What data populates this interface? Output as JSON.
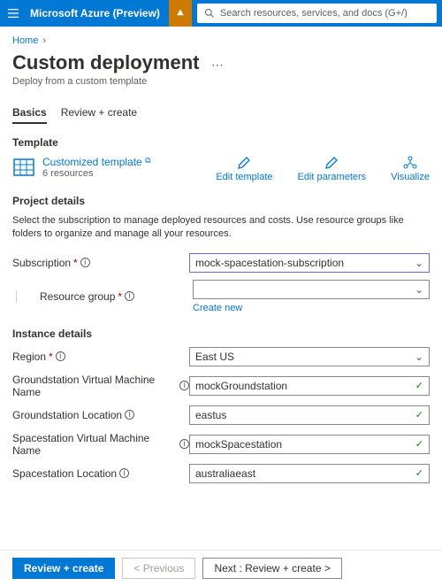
{
  "header": {
    "brand": "Microsoft Azure (Preview)",
    "search_placeholder": "Search resources, services, and docs (G+/)"
  },
  "breadcrumb": {
    "home": "Home"
  },
  "title": "Custom deployment",
  "subtitle": "Deploy from a custom template",
  "tabs": {
    "basics": "Basics",
    "review": "Review + create"
  },
  "template_section": {
    "heading": "Template",
    "name": "Customized template",
    "resources": "6 resources",
    "edit_template": "Edit template",
    "edit_parameters": "Edit parameters",
    "visualize": "Visualize"
  },
  "project": {
    "heading": "Project details",
    "intro": "Select the subscription to manage deployed resources and costs. Use resource groups like folders to organize and manage all your resources.",
    "subscription_label": "Subscription",
    "subscription_value": "mock-spacestation-subscription",
    "resource_group_label": "Resource group",
    "resource_group_value": "",
    "create_new": "Create new"
  },
  "instance": {
    "heading": "Instance details",
    "fields": {
      "region": {
        "label": "Region",
        "required": true,
        "type": "select",
        "value": "East US"
      },
      "gs_name": {
        "label": "Groundstation Virtual Machine Name",
        "required": false,
        "type": "text",
        "value": "mockGroundstation"
      },
      "gs_loc": {
        "label": "Groundstation Location",
        "required": false,
        "type": "text",
        "value": "eastus"
      },
      "ss_name": {
        "label": "Spacestation Virtual Machine Name",
        "required": false,
        "type": "text",
        "value": "mockSpacestation"
      },
      "ss_loc": {
        "label": "Spacestation Location",
        "required": false,
        "type": "text",
        "value": "australiaeast"
      }
    }
  },
  "footer": {
    "primary": "Review + create",
    "previous": "< Previous",
    "next": "Next : Review + create >"
  }
}
